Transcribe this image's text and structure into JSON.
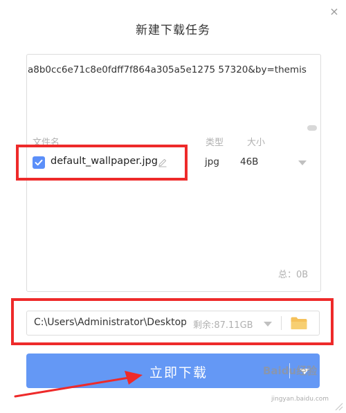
{
  "dialog": {
    "title": "新建下载任务",
    "close_glyph": "×"
  },
  "url_box": {
    "url_text": "a8b0cc6e71c8e0fdff7f864a305a5e1275  57320&by=themis"
  },
  "file_list": {
    "headers": {
      "name": "文件名",
      "type": "类型",
      "size": "大小"
    },
    "files": [
      {
        "name": "default_wallpaper.jpg",
        "type": "jpg",
        "size": "46B",
        "checked": true
      }
    ],
    "total": "总：0B"
  },
  "save_path": {
    "path": "C:\\Users\\Administrator\\Desktop",
    "free_space": "剩余:87.11GB"
  },
  "download_button": {
    "label": "立即下载"
  },
  "watermark": {
    "text": "Baidu经验",
    "sub_text": "jingyan.baidu.com"
  },
  "icons": {
    "checkbox": "checkmark-icon",
    "edit": "pencil-icon",
    "folder": "folder-icon",
    "dropdown": "chevron-down-icon"
  },
  "colors": {
    "accent_blue": "#6498f5",
    "checkbox_blue": "#5b8ff9",
    "annotation_red": "#ee2a2a",
    "folder_yellow": "#f5c15a",
    "muted_text": "#b0b0b0"
  }
}
